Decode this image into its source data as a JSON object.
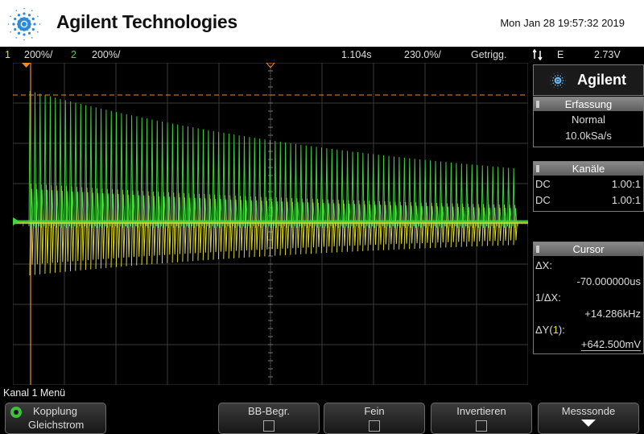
{
  "header": {
    "brand": "Agilent Technologies",
    "datetime": "Mon Jan 28 19:57:32 2019"
  },
  "status": {
    "ch1_num": "1",
    "ch1_scale": "200ᶜ/",
    "ch2_num": "2",
    "ch2_scale": "200ᶜ/",
    "time_pos": "1.104s",
    "time_scale": "230.0ᶜ/",
    "trigger_mode": "Getrigg.",
    "trigger_icon": "trigger-edge-icon",
    "trigger_source": "E",
    "trigger_level": "2.73V"
  },
  "colors": {
    "ch1": "#e5e232",
    "ch2": "#3fd93f",
    "cursor": "#f08a28",
    "grid": "#3a3a3a"
  },
  "panel": {
    "brand": "Agilent",
    "acquisition": {
      "title": "Erfassung",
      "mode": "Normal",
      "rate": "10.0kSa/s"
    },
    "channels": {
      "title": "Kanäle",
      "rows": [
        {
          "coupling": "DC",
          "probe": "1.00:1"
        },
        {
          "coupling": "DC",
          "probe": "1.00:1"
        }
      ]
    },
    "cursor": {
      "title": "Cursor",
      "dx_label": "ΔX:",
      "dx_value": "-70.000000us",
      "inv_label": "1/ΔX:",
      "inv_value": "+14.286kHz",
      "dy_label_pre": "ΔY(",
      "dy_label_ch": "1",
      "dy_label_post": "):",
      "dy_value": "+642.500mV"
    }
  },
  "menu": {
    "title": "Kanal 1 Menü",
    "softkeys": [
      {
        "label": "Kopplung",
        "value": "Gleichstrom"
      },
      {
        "label": "BB-Begr."
      },
      {
        "label": "Fein"
      },
      {
        "label": "Invertieren"
      },
      {
        "label": "Messsonde"
      }
    ]
  }
}
